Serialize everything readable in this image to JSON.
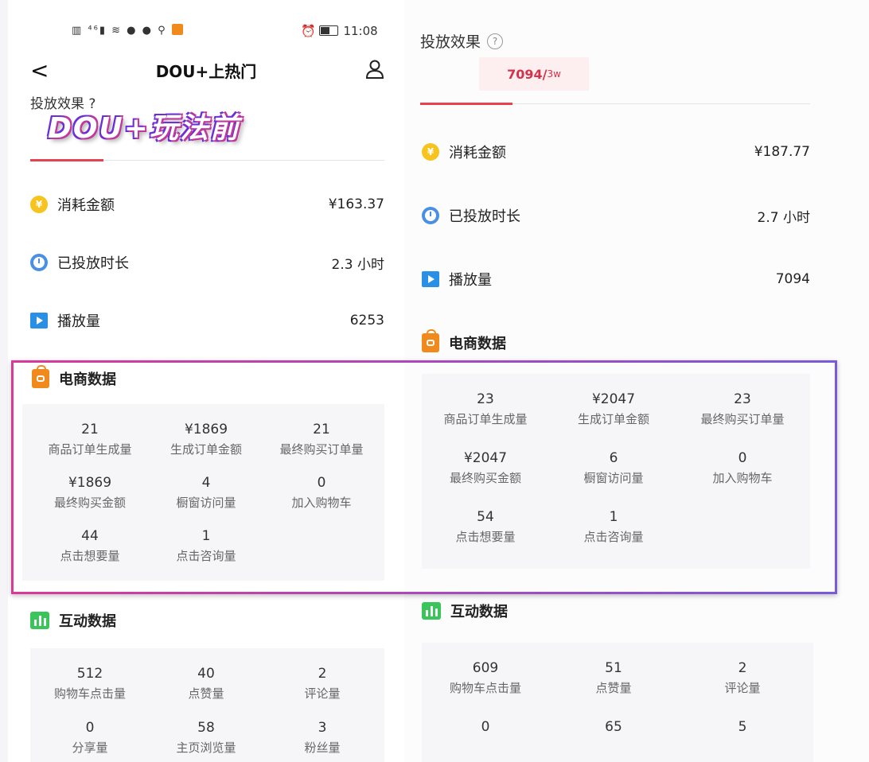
{
  "status_bar": {
    "time": "11:08",
    "left_icons": "▥ ⁴⁶▮ ≋ ● ●  ⚲"
  },
  "header": {
    "title": "DOU+上热门",
    "back": "<"
  },
  "left": {
    "cut_section": "投放效果 ?",
    "banner": "DOU+玩法前",
    "metrics": [
      {
        "label": "消耗金额",
        "value": "¥163.37",
        "icon": "coin-icon"
      },
      {
        "label": "已投放时长",
        "value": "2.3 小时",
        "icon": "clock-icon"
      },
      {
        "label": "播放量",
        "value": "6253",
        "icon": "play-icon"
      }
    ],
    "ecommerce_title": "电商数据",
    "ecommerce": [
      {
        "value": "21",
        "label": "商品订单生成量"
      },
      {
        "value": "¥1869",
        "label": "生成订单金额"
      },
      {
        "value": "21",
        "label": "最终购买订单量"
      },
      {
        "value": "¥1869",
        "label": "最终购买金额"
      },
      {
        "value": "4",
        "label": "橱窗访问量"
      },
      {
        "value": "0",
        "label": "加入购物车"
      },
      {
        "value": "44",
        "label": "点击想要量"
      },
      {
        "value": "1",
        "label": "点击咨询量"
      }
    ],
    "interaction_title": "互动数据",
    "interaction": [
      {
        "value": "512",
        "label": "购物车点击量"
      },
      {
        "value": "40",
        "label": "点赞量"
      },
      {
        "value": "2",
        "label": "评论量"
      },
      {
        "value": "0",
        "label": "分享量"
      },
      {
        "value": "58",
        "label": "主页浏览量"
      },
      {
        "value": "3",
        "label": "粉丝量"
      }
    ]
  },
  "right": {
    "effect_title": "投放效果",
    "question": "?",
    "pill_main": "7094/",
    "pill_sub": "3w",
    "metrics": [
      {
        "label": "消耗金额",
        "value": "¥187.77",
        "icon": "coin-icon"
      },
      {
        "label": "已投放时长",
        "value": "2.7 小时",
        "icon": "clock-icon"
      },
      {
        "label": "播放量",
        "value": "7094",
        "icon": "play-icon"
      }
    ],
    "ecommerce_title": "电商数据",
    "ecommerce": [
      {
        "value": "23",
        "label": "商品订单生成量"
      },
      {
        "value": "¥2047",
        "label": "生成订单金额"
      },
      {
        "value": "23",
        "label": "最终购买订单量"
      },
      {
        "value": "¥2047",
        "label": "最终购买金额"
      },
      {
        "value": "6",
        "label": "橱窗访问量"
      },
      {
        "value": "0",
        "label": "加入购物车"
      },
      {
        "value": "54",
        "label": "点击想要量"
      },
      {
        "value": "1",
        "label": "点击咨询量"
      }
    ],
    "interaction_title": "互动数据",
    "interaction": [
      {
        "value": "609",
        "label": "购物车点击量"
      },
      {
        "value": "51",
        "label": "点赞量"
      },
      {
        "value": "2",
        "label": "评论量"
      },
      {
        "value": "0",
        "label": ""
      },
      {
        "value": "65",
        "label": ""
      },
      {
        "value": "5",
        "label": ""
      }
    ]
  },
  "colors": {
    "accent": "#e8424e",
    "frame_start": "#d83a98",
    "frame_end": "#7a5ad8"
  }
}
